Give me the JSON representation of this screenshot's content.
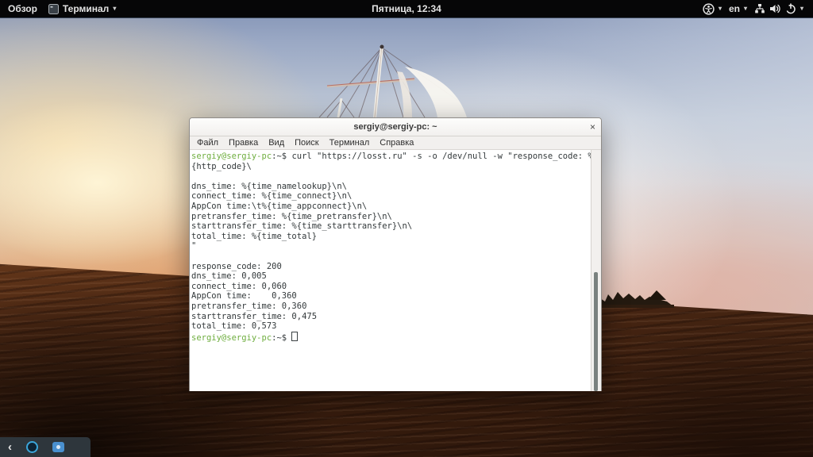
{
  "topbar": {
    "activities": "Обзор",
    "app_name": "Терминал",
    "clock": "Пятница, 12:34",
    "language": "en",
    "caret_glyph": "▾"
  },
  "window": {
    "title": "sergiy@sergiy-pc: ~",
    "close_glyph": "×",
    "menu": [
      "Файл",
      "Правка",
      "Вид",
      "Поиск",
      "Терминал",
      "Справка"
    ]
  },
  "terminal": {
    "lines": [
      {
        "user": "sergiy@sergiy-pc",
        "rest": ":~$ curl \"https://losst.ru\" -s -o /dev/null -w \"response_code: %"
      },
      {
        "text": "{http_code}\\"
      },
      {
        "text": ""
      },
      {
        "text": "dns_time: %{time_namelookup}\\n\\"
      },
      {
        "text": "connect_time: %{time_connect}\\n\\"
      },
      {
        "text": "AppCon time:\\t%{time_appconnect}\\n\\"
      },
      {
        "text": "pretransfer_time: %{time_pretransfer}\\n\\"
      },
      {
        "text": "starttransfer_time: %{time_starttransfer}\\n\\"
      },
      {
        "text": "total_time: %{time_total}"
      },
      {
        "text": "\""
      },
      {
        "text": ""
      },
      {
        "text": "response_code: 200"
      },
      {
        "text": "dns_time: 0,005"
      },
      {
        "text": "connect_time: 0,060"
      },
      {
        "text": "AppCon time:    0,360"
      },
      {
        "text": "pretransfer_time: 0,360"
      },
      {
        "text": "starttransfer_time: 0,475"
      },
      {
        "text": "total_time: 0,573"
      },
      {
        "user": "sergiy@sergiy-pc",
        "rest": ":~$ ",
        "cursor": true
      }
    ]
  },
  "dock": {
    "back_glyph": "‹"
  },
  "colors": {
    "prompt_green": "#6fae3f",
    "dock_accent_blue": "#3ba6da",
    "camera_blue": "#4a90cf",
    "topbar_bg": "#060607",
    "terminal_bg": "#ffffff",
    "terminal_text": "#32383a"
  }
}
